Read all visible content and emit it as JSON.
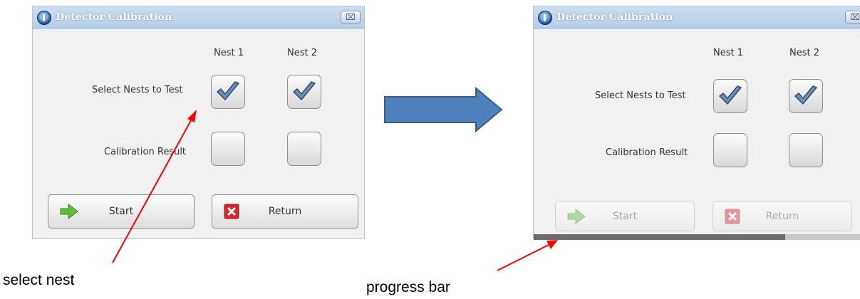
{
  "windows": [
    {
      "title": "Detector Calibration",
      "close_label": "⌧",
      "nest_headers": [
        "Nest 1",
        "Nest 2"
      ],
      "select_label": "Select Nests to Test",
      "result_label": "Calibration Result",
      "nest_checked": [
        true,
        true
      ],
      "result_checked": [
        false,
        false
      ],
      "start_label": "Start",
      "return_label": "Return",
      "buttons_enabled": true
    },
    {
      "title": "Detector Calibration",
      "close_label": "⌧",
      "nest_headers": [
        "Nest 1",
        "Nest 2"
      ],
      "select_label": "Select Nests to Test",
      "result_label": "Calibration Result",
      "nest_checked": [
        true,
        true
      ],
      "result_checked": [
        false,
        false
      ],
      "start_label": "Start",
      "return_label": "Return",
      "buttons_enabled": false,
      "progress_fraction": 0.77
    }
  ],
  "annotations": {
    "select_nest": "select nest",
    "progress_bar": "progress bar",
    "arrow_color": "#ff0000",
    "flow_arrow_color": "#4f81bd"
  }
}
